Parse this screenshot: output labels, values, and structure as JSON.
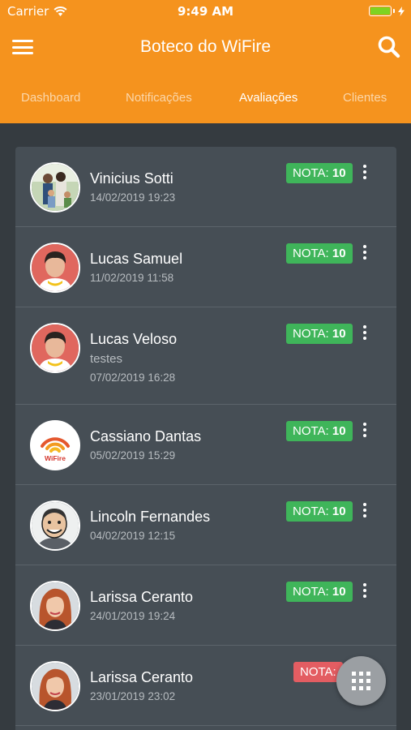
{
  "status_bar": {
    "carrier": "Carrier",
    "time": "9:49 AM"
  },
  "header": {
    "title": "Boteco do WiFire"
  },
  "tabs": [
    {
      "label": "Dashboard",
      "active": false
    },
    {
      "label": "Notificações",
      "active": false
    },
    {
      "label": "Avaliações",
      "active": true
    },
    {
      "label": "Clientes",
      "active": false
    }
  ],
  "reviews": [
    {
      "name": "Vinicius Sotti",
      "comment": "",
      "date": "14/02/2019 19:23",
      "badge_label": "NOTA:",
      "score": "10",
      "badge_color": "#3fb55a",
      "avatar_icon": "family-photo-icon"
    },
    {
      "name": "Lucas Samuel",
      "comment": "",
      "date": "11/02/2019 11:58",
      "badge_label": "NOTA:",
      "score": "10",
      "badge_color": "#3fb55a",
      "avatar_icon": "boy-photo-icon"
    },
    {
      "name": "Lucas Veloso",
      "comment": "testes",
      "date": "07/02/2019 16:28",
      "badge_label": "NOTA:",
      "score": "10",
      "badge_color": "#3fb55a",
      "avatar_icon": "boy-photo-icon"
    },
    {
      "name": "Cassiano Dantas",
      "comment": "",
      "date": "05/02/2019 15:29",
      "badge_label": "NOTA:",
      "score": "10",
      "badge_color": "#3fb55a",
      "avatar_icon": "wifire-logo-icon",
      "logo_text": "WiFire"
    },
    {
      "name": "Lincoln Fernandes",
      "comment": "",
      "date": "04/02/2019 12:15",
      "badge_label": "NOTA:",
      "score": "10",
      "badge_color": "#3fb55a",
      "avatar_icon": "caricature-photo-icon"
    },
    {
      "name": "Larissa Ceranto",
      "comment": "",
      "date": "24/01/2019 19:24",
      "badge_label": "NOTA:",
      "score": "10",
      "badge_color": "#3fb55a",
      "avatar_icon": "woman-photo-icon"
    },
    {
      "name": "Larissa Ceranto",
      "comment": "",
      "date": "23/01/2019 23:02",
      "badge_label": "NOTA:",
      "score": "",
      "badge_color": "#e35d62",
      "avatar_icon": "woman-photo-icon"
    }
  ],
  "colors": {
    "header": "#f5931e",
    "background": "#353b40",
    "card": "#464e55",
    "badge_green": "#3fb55a",
    "badge_red": "#e35d62"
  },
  "icons": {
    "menu": "hamburger-menu-icon",
    "search": "search-icon",
    "more": "kebab-menu-icon",
    "fab": "grid-apps-icon"
  }
}
